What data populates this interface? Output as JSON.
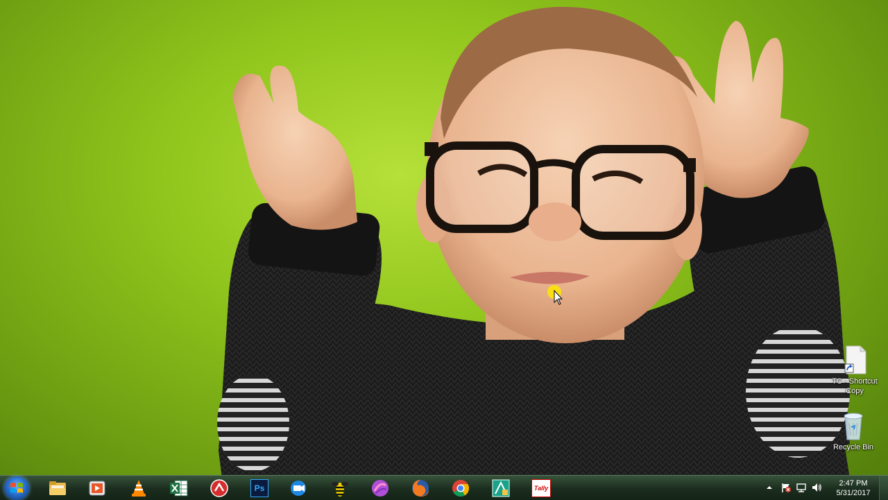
{
  "desktop": {
    "icons": [
      {
        "label_line1": "TC - Shortcut",
        "label_line2": "Copy",
        "icon": "file-shortcut-icon"
      },
      {
        "label_line1": "Recycle Bin",
        "icon": "recycle-bin-icon"
      }
    ]
  },
  "taskbar": {
    "start_icon": "windows-start-icon",
    "pinned": [
      {
        "name": "windows-explorer",
        "icon": "folder-icon"
      },
      {
        "name": "media-player",
        "icon": "media-player-icon"
      },
      {
        "name": "vlc",
        "icon": "vlc-cone-icon"
      },
      {
        "name": "excel",
        "icon": "excel-icon"
      },
      {
        "name": "red-app",
        "icon": "red-circle-app-icon"
      },
      {
        "name": "photoshop",
        "icon": "photoshop-icon",
        "text": "Ps"
      },
      {
        "name": "video-app",
        "icon": "video-camera-icon"
      },
      {
        "name": "bee-app",
        "icon": "bee-icon"
      },
      {
        "name": "purple-app",
        "icon": "purple-orb-icon"
      },
      {
        "name": "firefox",
        "icon": "firefox-icon"
      },
      {
        "name": "chrome",
        "icon": "chrome-icon"
      },
      {
        "name": "green-frame-app",
        "icon": "green-frame-icon"
      },
      {
        "name": "tally",
        "icon": "tally-icon",
        "text": "Tally"
      }
    ],
    "tray": {
      "icons": [
        "show-hidden-icons-arrow",
        "action-center-flag-icon",
        "network-icon",
        "volume-icon"
      ],
      "time": "2:47 PM",
      "date": "5/31/2017"
    }
  },
  "colors": {
    "wallpaper_green": "#8fc51c",
    "taskbar": "#1b2d1e",
    "clock_text": "#ffffff"
  }
}
